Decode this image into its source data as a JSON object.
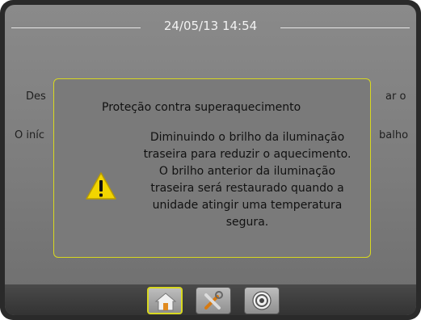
{
  "header": {
    "datetime": "24/05/13 14:54"
  },
  "background_text": {
    "line1_left": "Des",
    "line1_right": "ar o",
    "line2_left": "O iníc",
    "line2_right": "balho"
  },
  "dialog": {
    "title": "Proteção contra superaquecimento",
    "message": "Diminuindo o brilho da iluminação\ntraseira para reduzir o aquecimento.\nO brilho anterior da iluminação\ntraseira será restaurado quando a\nunidade atingir uma temperatura\nsegura.",
    "icon": "warning-triangle-icon"
  },
  "taskbar": {
    "buttons": [
      {
        "icon": "home-icon",
        "active": true
      },
      {
        "icon": "tools-icon",
        "active": false
      },
      {
        "icon": "target-icon",
        "active": false
      }
    ]
  },
  "colors": {
    "accent": "#d8d820",
    "warning": "#f2d500"
  }
}
